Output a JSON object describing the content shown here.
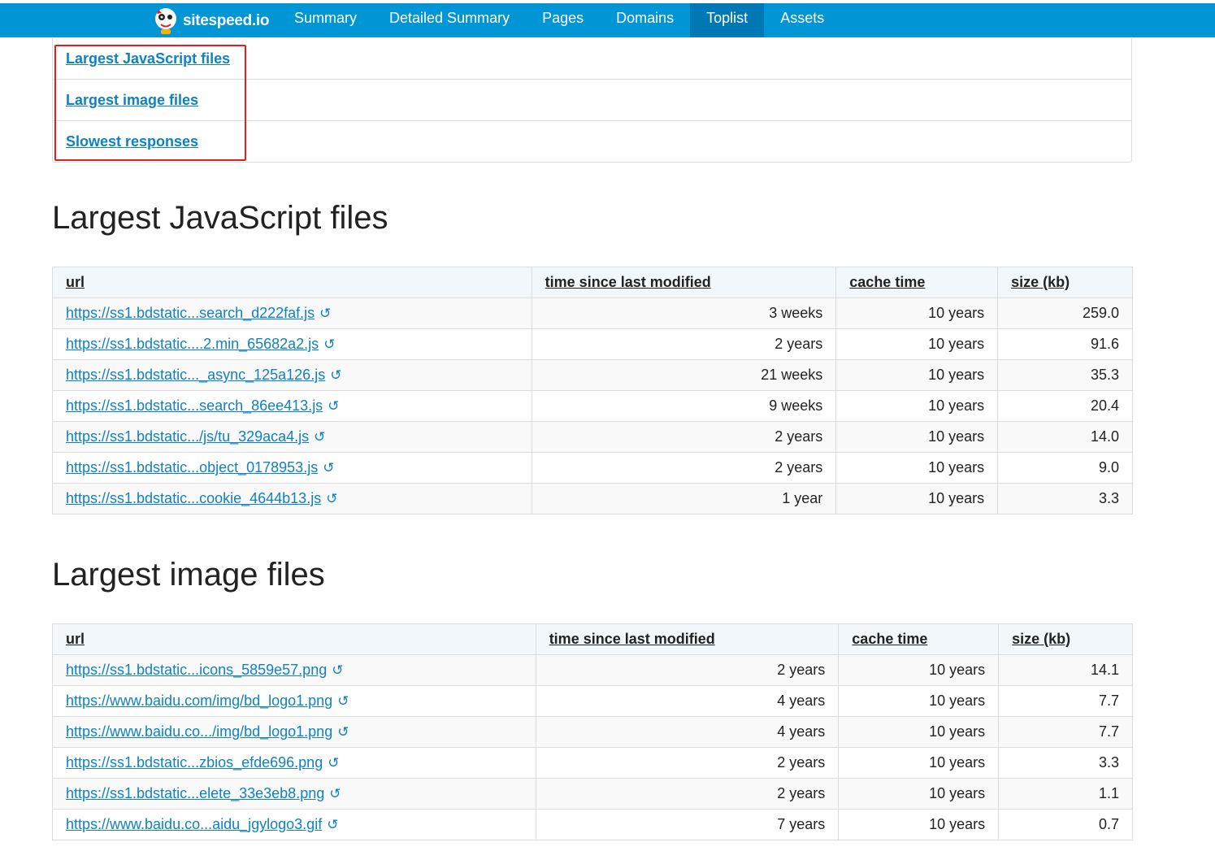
{
  "nav": {
    "brand": "sitespeed.io",
    "items": [
      "Summary",
      "Detailed Summary",
      "Pages",
      "Domains",
      "Toplist",
      "Assets"
    ],
    "active": "Toplist"
  },
  "toc": [
    "Largest JavaScript files",
    "Largest image files",
    "Slowest responses"
  ],
  "js_section": {
    "title": "Largest JavaScript files",
    "headers": [
      "url",
      "time since last modified",
      "cache time",
      "size (kb)"
    ],
    "rows": [
      {
        "url": "https://ss1.bdstatic...search_d222faf.js",
        "modified": "3 weeks",
        "cache": "10 years",
        "size": "259.0"
      },
      {
        "url": "https://ss1.bdstatic....2.min_65682a2.js",
        "modified": "2 years",
        "cache": "10 years",
        "size": "91.6"
      },
      {
        "url": "https://ss1.bdstatic..._async_125a126.js",
        "modified": "21 weeks",
        "cache": "10 years",
        "size": "35.3"
      },
      {
        "url": "https://ss1.bdstatic...search_86ee413.js",
        "modified": "9 weeks",
        "cache": "10 years",
        "size": "20.4"
      },
      {
        "url": "https://ss1.bdstatic.../js/tu_329aca4.js",
        "modified": "2 years",
        "cache": "10 years",
        "size": "14.0"
      },
      {
        "url": "https://ss1.bdstatic...object_0178953.js",
        "modified": "2 years",
        "cache": "10 years",
        "size": "9.0"
      },
      {
        "url": "https://ss1.bdstatic...cookie_4644b13.js",
        "modified": "1 year",
        "cache": "10 years",
        "size": "3.3"
      }
    ]
  },
  "img_section": {
    "title": "Largest image files",
    "headers": [
      "url",
      "time since last modified",
      "cache time",
      "size (kb)"
    ],
    "rows": [
      {
        "url": "https://ss1.bdstatic...icons_5859e57.png",
        "modified": "2 years",
        "cache": "10 years",
        "size": "14.1"
      },
      {
        "url": "https://www.baidu.com/img/bd_logo1.png",
        "modified": "4 years",
        "cache": "10 years",
        "size": "7.7"
      },
      {
        "url": "https://www.baidu.co.../img/bd_logo1.png",
        "modified": "4 years",
        "cache": "10 years",
        "size": "7.7"
      },
      {
        "url": "https://ss1.bdstatic...zbios_efde696.png",
        "modified": "2 years",
        "cache": "10 years",
        "size": "3.3"
      },
      {
        "url": "https://ss1.bdstatic...elete_33e3eb8.png",
        "modified": "2 years",
        "cache": "10 years",
        "size": "1.1"
      },
      {
        "url": "https://www.baidu.co...aidu_jgylogo3.gif",
        "modified": "7 years",
        "cache": "10 years",
        "size": "0.7"
      }
    ]
  },
  "icons": {
    "reload": "↺"
  }
}
